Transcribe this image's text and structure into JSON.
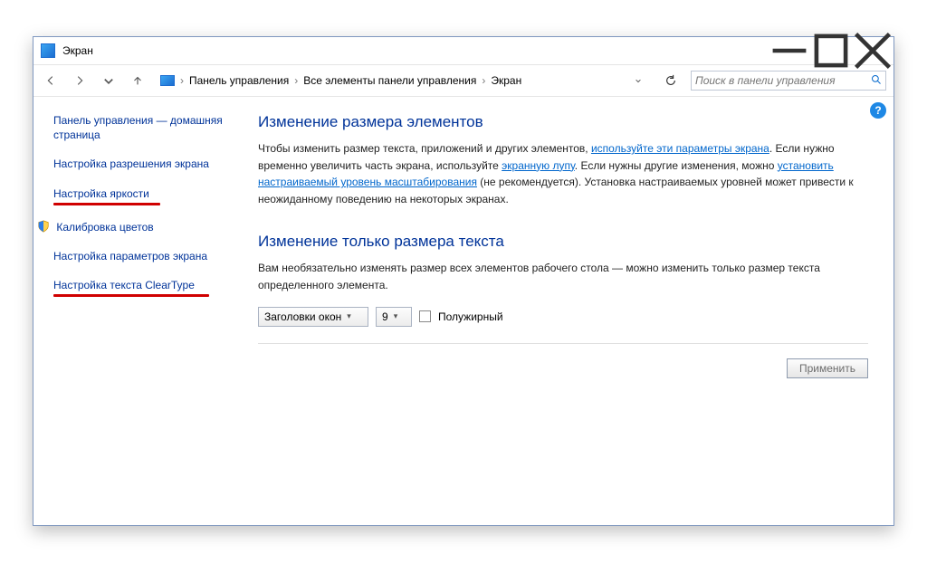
{
  "window": {
    "title": "Экран"
  },
  "breadcrumb": {
    "items": [
      "Панель управления",
      "Все элементы панели управления",
      "Экран"
    ]
  },
  "search": {
    "placeholder": "Поиск в панели управления"
  },
  "sidebar": {
    "home": "Панель управления — домашняя страница",
    "resolution": "Настройка разрешения экрана",
    "brightness": "Настройка яркости",
    "calibration": "Калибровка цветов",
    "params": "Настройка параметров экрана",
    "cleartype": "Настройка текста ClearType"
  },
  "main": {
    "heading1": "Изменение размера элементов",
    "para1_a": "Чтобы изменить размер текста, приложений и других элементов, ",
    "link1": "используйте эти параметры экрана",
    "para1_b": ". Если нужно временно увеличить часть экрана, используйте ",
    "link2": "экранную лупу",
    "para1_c": ". Если нужны другие изменения, можно ",
    "link3": "установить настраиваемый уровень масштабирования",
    "para1_d": " (не рекомендуется). Установка настраиваемых уровней может привести к неожиданному поведению на некоторых экранах.",
    "heading2": "Изменение только размера текста",
    "para2": "Вам необязательно изменять размер всех элементов рабочего стола — можно изменить только размер текста определенного элемента.",
    "select1": "Заголовки окон",
    "select2": "9",
    "bold_label": "Полужирный",
    "apply": "Применить"
  }
}
